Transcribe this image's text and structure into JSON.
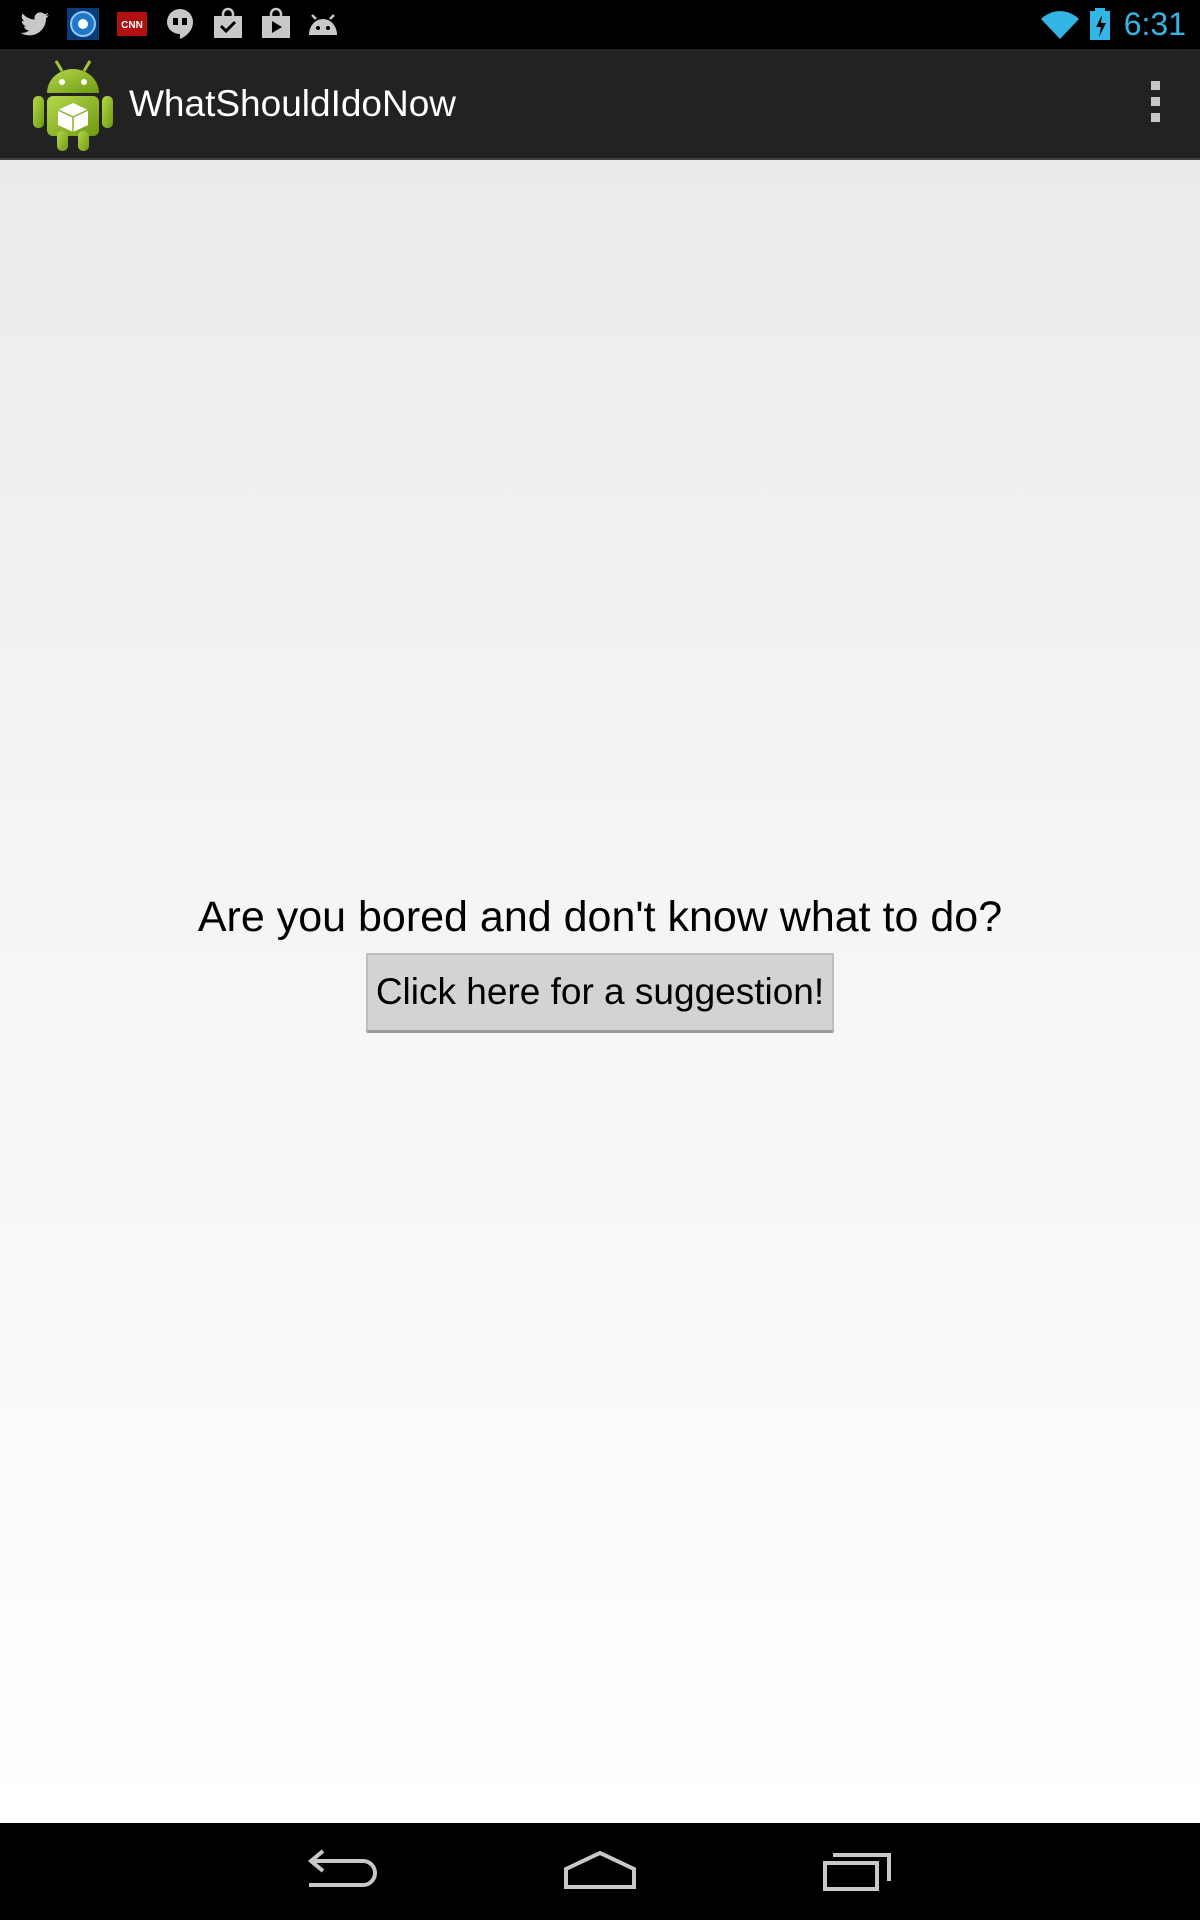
{
  "status_bar": {
    "time": "6:31",
    "notification_icons": [
      "twitter-icon",
      "news-app-icon",
      "cnn-icon",
      "hangouts-icon",
      "shopping-bag-icon",
      "play-store-icon",
      "android-game-icon"
    ],
    "system_icons": [
      "wifi-icon",
      "battery-charging-icon"
    ],
    "accent_color": "#33b5e5"
  },
  "action_bar": {
    "title": "WhatShouldIdoNow",
    "app_icon": "android-app-icon",
    "overflow_icon": "overflow-menu-icon"
  },
  "main": {
    "prompt": "Are you bored and don't know what to do?",
    "button_label": "Click here for a suggestion!"
  },
  "nav_bar": {
    "buttons": [
      "back-icon",
      "home-icon",
      "recent-apps-icon"
    ]
  }
}
